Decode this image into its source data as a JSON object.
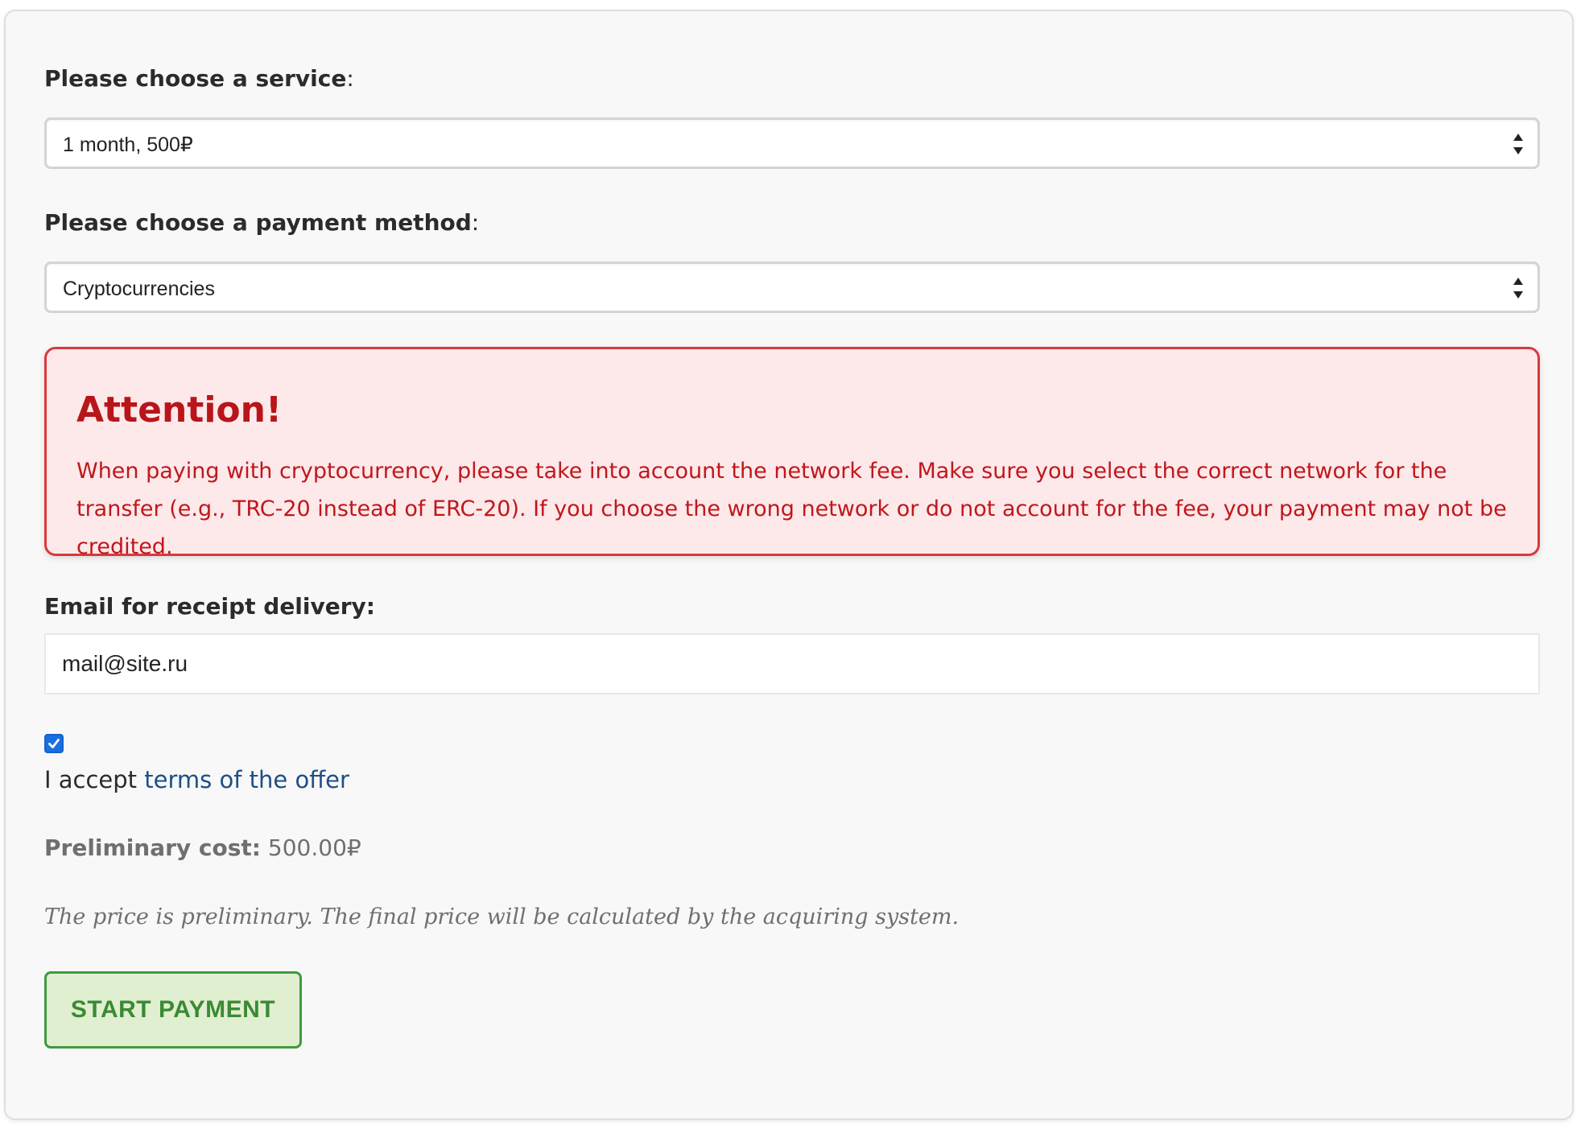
{
  "form": {
    "service": {
      "label": "Please choose a service",
      "colon": ":",
      "selected": "1 month, 500₽"
    },
    "payment_method": {
      "label": "Please choose a payment method",
      "colon": ":",
      "selected": "Cryptocurrencies"
    },
    "alert": {
      "title": "Attention!",
      "body": "When paying with cryptocurrency, please take into account the network fee. Make sure you select the correct network for the transfer (e.g., TRC-20 instead of ERC-20). If you choose the wrong network or do not account for the fee, your payment may not be credited."
    },
    "email": {
      "label": "Email for receipt delivery:",
      "value": "mail@site.ru"
    },
    "terms": {
      "checked": true,
      "prefix": "I accept ",
      "link_text": "terms of the offer"
    },
    "cost": {
      "label": "Preliminary cost:",
      "value": "500.00₽"
    },
    "note": "The price is preliminary. The final price will be calculated by the acquiring system.",
    "submit_label": "START PAYMENT"
  },
  "colors": {
    "alert_text": "#c0171b",
    "alert_background": "#fde8ea",
    "alert_border": "#d9393a",
    "link": "#1d4f86",
    "checkbox": "#1a6fe0",
    "button_background": "#e0efcf",
    "button_border": "#3f9a3f",
    "button_text": "#3a8a35"
  },
  "icons": {
    "select_arrows": "up-down-arrows-icon",
    "checkbox_check": "checkmark-icon"
  }
}
